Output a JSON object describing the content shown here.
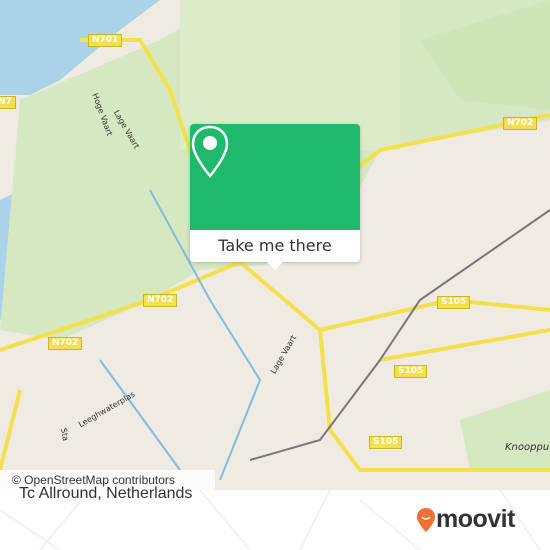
{
  "map": {
    "attribution": "© OpenStreetMap contributors",
    "road_labels": [
      "N701",
      "N702",
      "N702",
      "N702",
      "S105",
      "S105",
      "S105",
      "N7"
    ],
    "place_labels": [
      "Hoge Vaart",
      "Lage Vaart",
      "Lage Vaart",
      "Leeghwaterplas",
      "Knooppu",
      "Sta"
    ],
    "colors": {
      "water": "#a9d3e8",
      "green": "#d6e8c2",
      "road": "#f4e04d",
      "land": "#efeae2"
    }
  },
  "popup": {
    "button_label": "Take me there",
    "icon": "map-pin-icon",
    "color": "#1fb96b"
  },
  "footer": {
    "place_name": "Tc Allround, Netherlands",
    "brand": "moovit",
    "brand_color": "#f36f36"
  }
}
